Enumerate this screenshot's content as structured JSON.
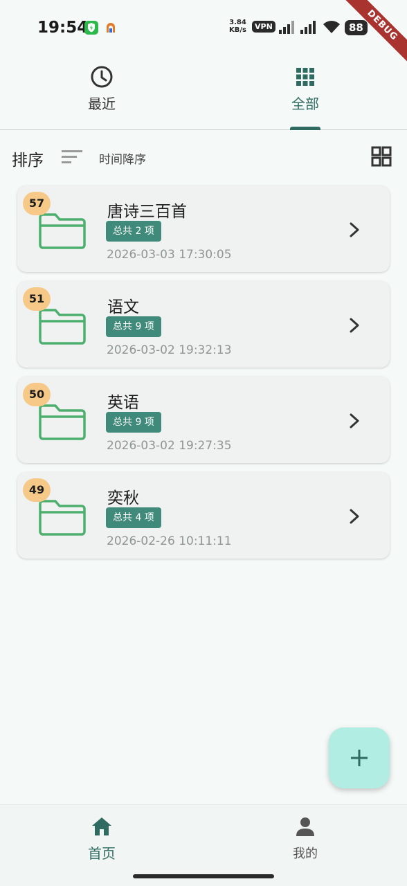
{
  "status_bar": {
    "time": "19:54",
    "speed_value": "3.84",
    "speed_unit": "KB/s",
    "vpn": "VPN",
    "battery": "88",
    "debug_banner": "DEBUG"
  },
  "tabs": [
    {
      "label": "最近",
      "icon": "clock-icon",
      "selected": false
    },
    {
      "label": "全部",
      "icon": "grid-icon",
      "selected": true
    }
  ],
  "sort": {
    "label": "排序",
    "value": "时间降序"
  },
  "folders": [
    {
      "count": "57",
      "title": "唐诗三百首",
      "items": "总共 2 项",
      "date": "2026-03-03 17:30:05"
    },
    {
      "count": "51",
      "title": "语文",
      "items": "总共 9 项",
      "date": "2026-03-02 19:32:13"
    },
    {
      "count": "50",
      "title": "英语",
      "items": "总共 9 项",
      "date": "2026-03-02 19:27:35"
    },
    {
      "count": "49",
      "title": "奕秋",
      "items": "总共 4 项",
      "date": "2026-02-26 10:11:11"
    }
  ],
  "bottom_nav": [
    {
      "label": "首页",
      "icon": "home-icon",
      "selected": true
    },
    {
      "label": "我的",
      "icon": "person-icon",
      "selected": false
    }
  ],
  "colors": {
    "accent": "#2f6b60",
    "badge": "#f7c989",
    "pill": "#3f8a7a",
    "folder": "#4caf6e",
    "fab": "#b2ede3"
  }
}
